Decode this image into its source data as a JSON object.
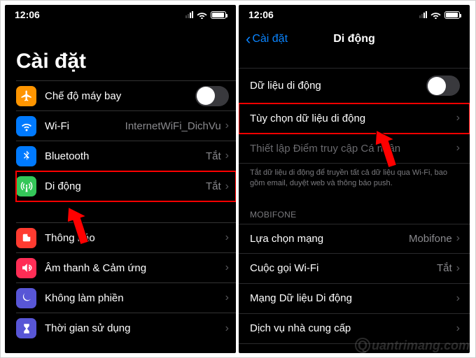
{
  "status": {
    "time": "12:06"
  },
  "watermark": "uantrimang.com",
  "left": {
    "title": "Cài đặt",
    "rows": {
      "airplane": {
        "label": "Chế độ máy bay"
      },
      "wifi": {
        "label": "Wi-Fi",
        "value": "InternetWiFi_DichVu"
      },
      "bluetooth": {
        "label": "Bluetooth",
        "value": "Tắt"
      },
      "cellular": {
        "label": "Di động",
        "value": "Tắt"
      },
      "notif": {
        "label": "Thông báo"
      },
      "sound": {
        "label": "Âm thanh & Cảm ứng"
      },
      "dnd": {
        "label": "Không làm phiền"
      },
      "screentime": {
        "label": "Thời gian sử dụng"
      }
    }
  },
  "right": {
    "back": "Cài đặt",
    "title": "Di động",
    "rows": {
      "mobiledata": {
        "label": "Dữ liệu di động"
      },
      "dataoptions": {
        "label": "Tùy chọn dữ liệu di động"
      },
      "hotspot": {
        "label": "Thiết lập Điểm truy cập Cá nhân"
      },
      "footer": "Tắt dữ liệu di động để truyền tất cả dữ liệu qua Wi-Fi, bao gồm email, duyệt web và thông báo push.",
      "carrier_head": "MOBIFONE",
      "netsel": {
        "label": "Lựa chọn mạng",
        "value": "Mobifone"
      },
      "wificall": {
        "label": "Cuộc gọi Wi-Fi",
        "value": "Tắt"
      },
      "mobilenet": {
        "label": "Mạng Dữ liệu Di động"
      },
      "carrierserv": {
        "label": "Dịch vụ nhà cung cấp"
      }
    }
  }
}
